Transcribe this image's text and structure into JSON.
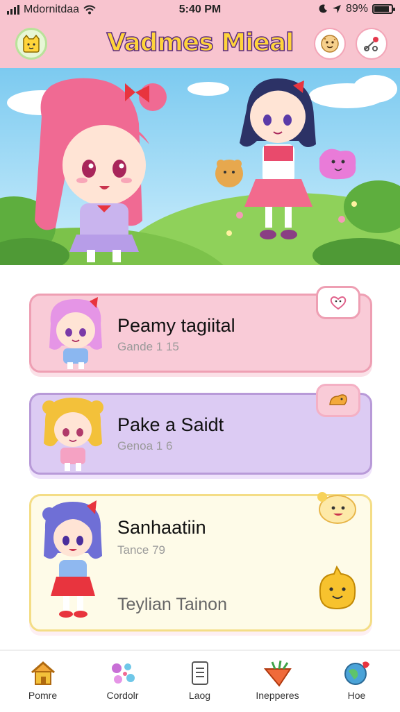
{
  "status_bar": {
    "carrier": "Mdornitdaa",
    "time": "5:40 PM",
    "battery": "89%",
    "battery_level": 0.89
  },
  "header": {
    "title": "Vadmes Mieal",
    "logo_icon": "cat-face-icon",
    "buttons": [
      {
        "icon": "cookie-face-icon"
      },
      {
        "icon": "settings-toggle-icon"
      }
    ]
  },
  "banner": {
    "description_icon": "characters-meadow-illustration"
  },
  "cards": [
    {
      "title": "Peamy tagiital",
      "subtitle": "Gande 1 15",
      "extra": "",
      "accent": "#ee9fb3",
      "badge_icon": "heart-bubble-icon"
    },
    {
      "title": "Pake a Saidt",
      "subtitle": "Genoa 1 6",
      "extra": "",
      "accent": "#b89ad8",
      "badge_icon": "dino-icon"
    },
    {
      "title": "Sanhaatiin",
      "subtitle": "Tance 79",
      "extra": "Teylian Tainon",
      "accent": "#f4dd86",
      "badge_icon": "smile-icon"
    }
  ],
  "bottom_nav": [
    {
      "label": "Pomre",
      "icon": "home-icon"
    },
    {
      "label": "Cordolr",
      "icon": "bubbles-icon"
    },
    {
      "label": "Laog",
      "icon": "document-icon"
    },
    {
      "label": "Inepperes",
      "icon": "carrot-icon"
    },
    {
      "label": "Hoe",
      "icon": "globe-icon"
    }
  ]
}
